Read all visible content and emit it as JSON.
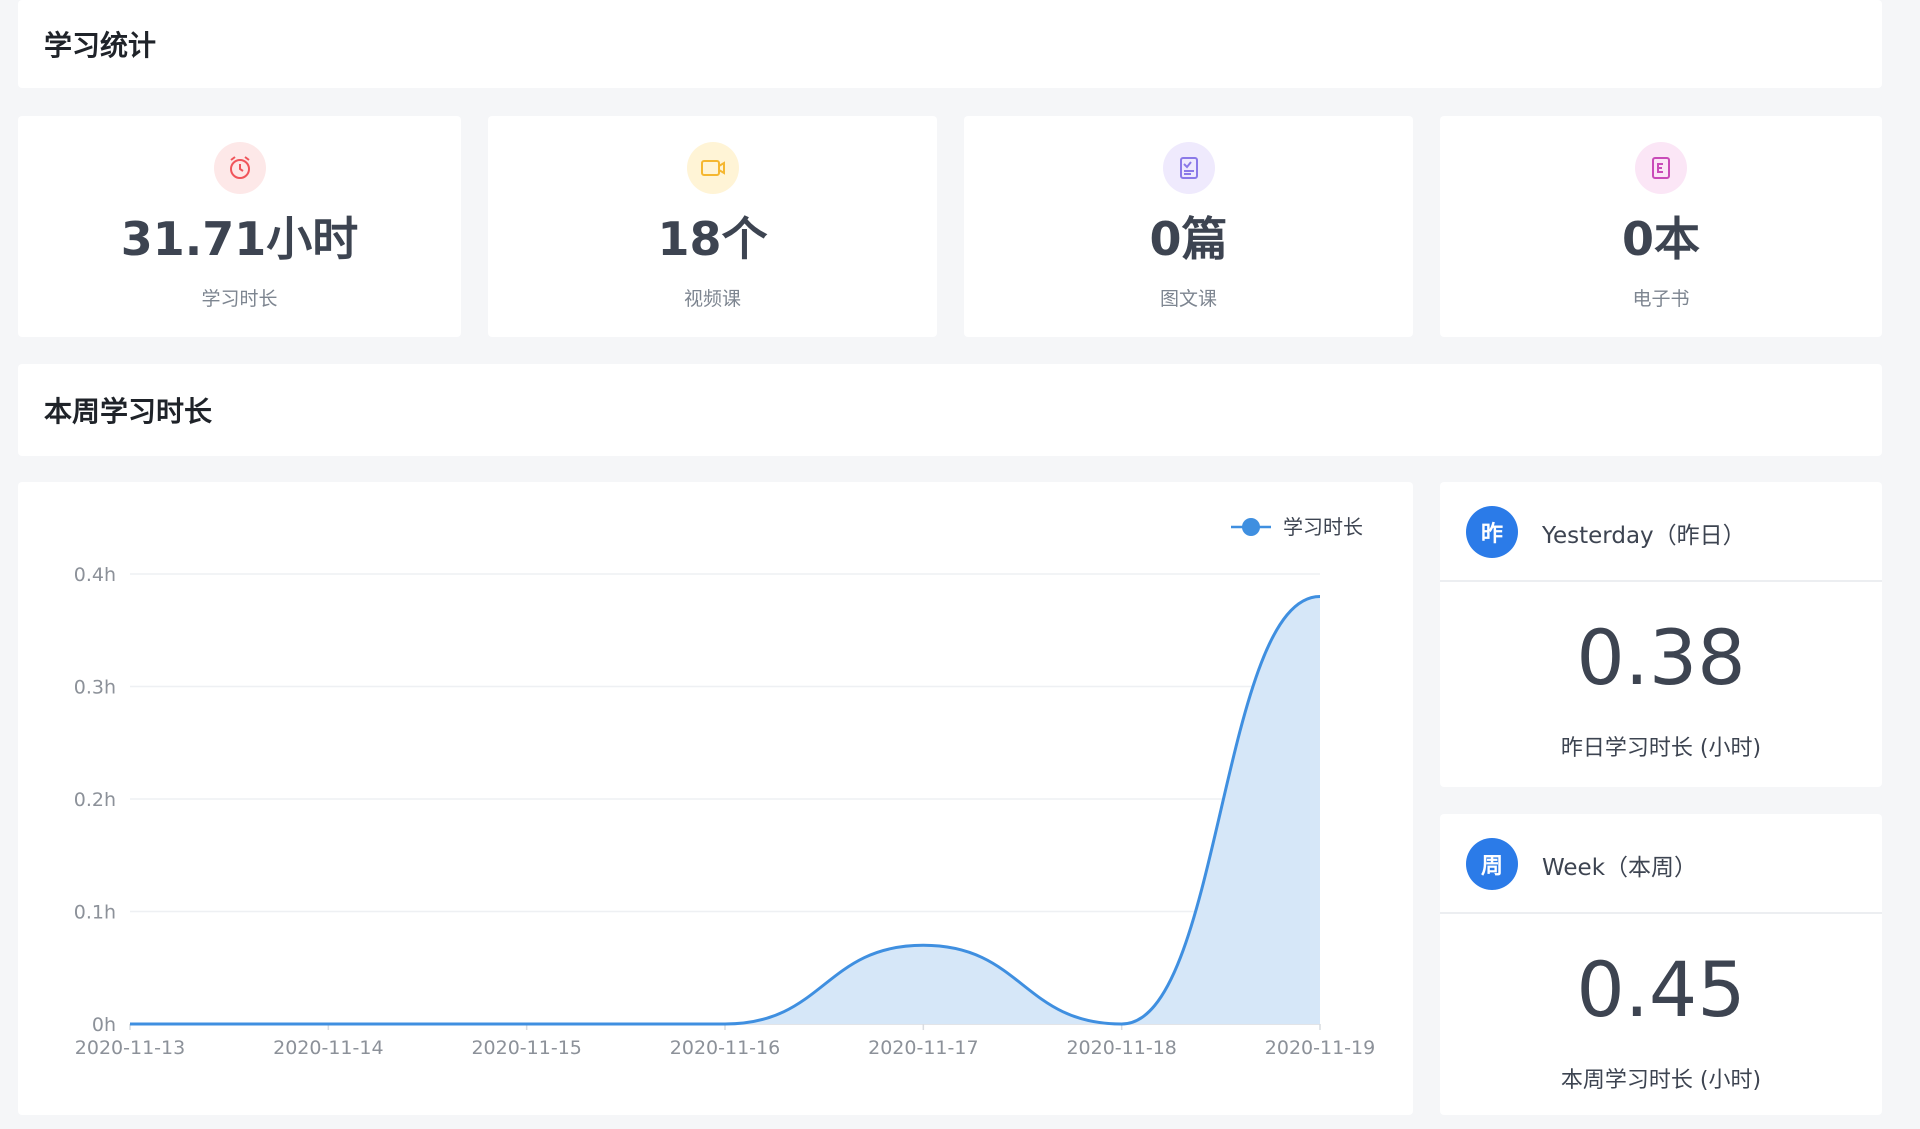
{
  "header": {
    "title": "学习统计"
  },
  "stats": [
    {
      "value": "31.71小时",
      "label": "学习时长",
      "icon": "alarm-clock-icon",
      "icon_color": "#f0555b",
      "icon_bg": "#fde8e8"
    },
    {
      "value": "18个",
      "label": "视频课",
      "icon": "video-icon",
      "icon_color": "#f5b731",
      "icon_bg": "#fff4d6"
    },
    {
      "value": "0篇",
      "label": "图文课",
      "icon": "article-icon",
      "icon_color": "#8b7ae8",
      "icon_bg": "#efeafd"
    },
    {
      "value": "0本",
      "label": "电子书",
      "icon": "ebook-icon",
      "icon_color": "#c94bb8",
      "icon_bg": "#fbe6f6"
    }
  ],
  "weekly": {
    "title": "本周学习时长"
  },
  "yesterday": {
    "badge": "昨",
    "title": "Yesterday（昨日）",
    "value": "0.38",
    "caption": "昨日学习时长 (小时)"
  },
  "week": {
    "badge": "周",
    "title": "Week（本周）",
    "value": "0.45",
    "caption": "本周学习时长 (小时)"
  },
  "colors": {
    "accent": "#2b7be8",
    "line": "#3f8fe0",
    "area": "#d6e7f8"
  },
  "chart_data": {
    "type": "area",
    "x": [
      "2020-11-13",
      "2020-11-14",
      "2020-11-15",
      "2020-11-16",
      "2020-11-17",
      "2020-11-18",
      "2020-11-19"
    ],
    "series": [
      {
        "name": "学习时长",
        "values": [
          0,
          0,
          0,
          0,
          0.07,
          0,
          0.38
        ]
      }
    ],
    "y_ticks": [
      "0h",
      "0.1h",
      "0.2h",
      "0.3h",
      "0.4h"
    ],
    "ylim": [
      0,
      0.4
    ],
    "grid": true,
    "legend": "top-right",
    "smooth": true
  }
}
